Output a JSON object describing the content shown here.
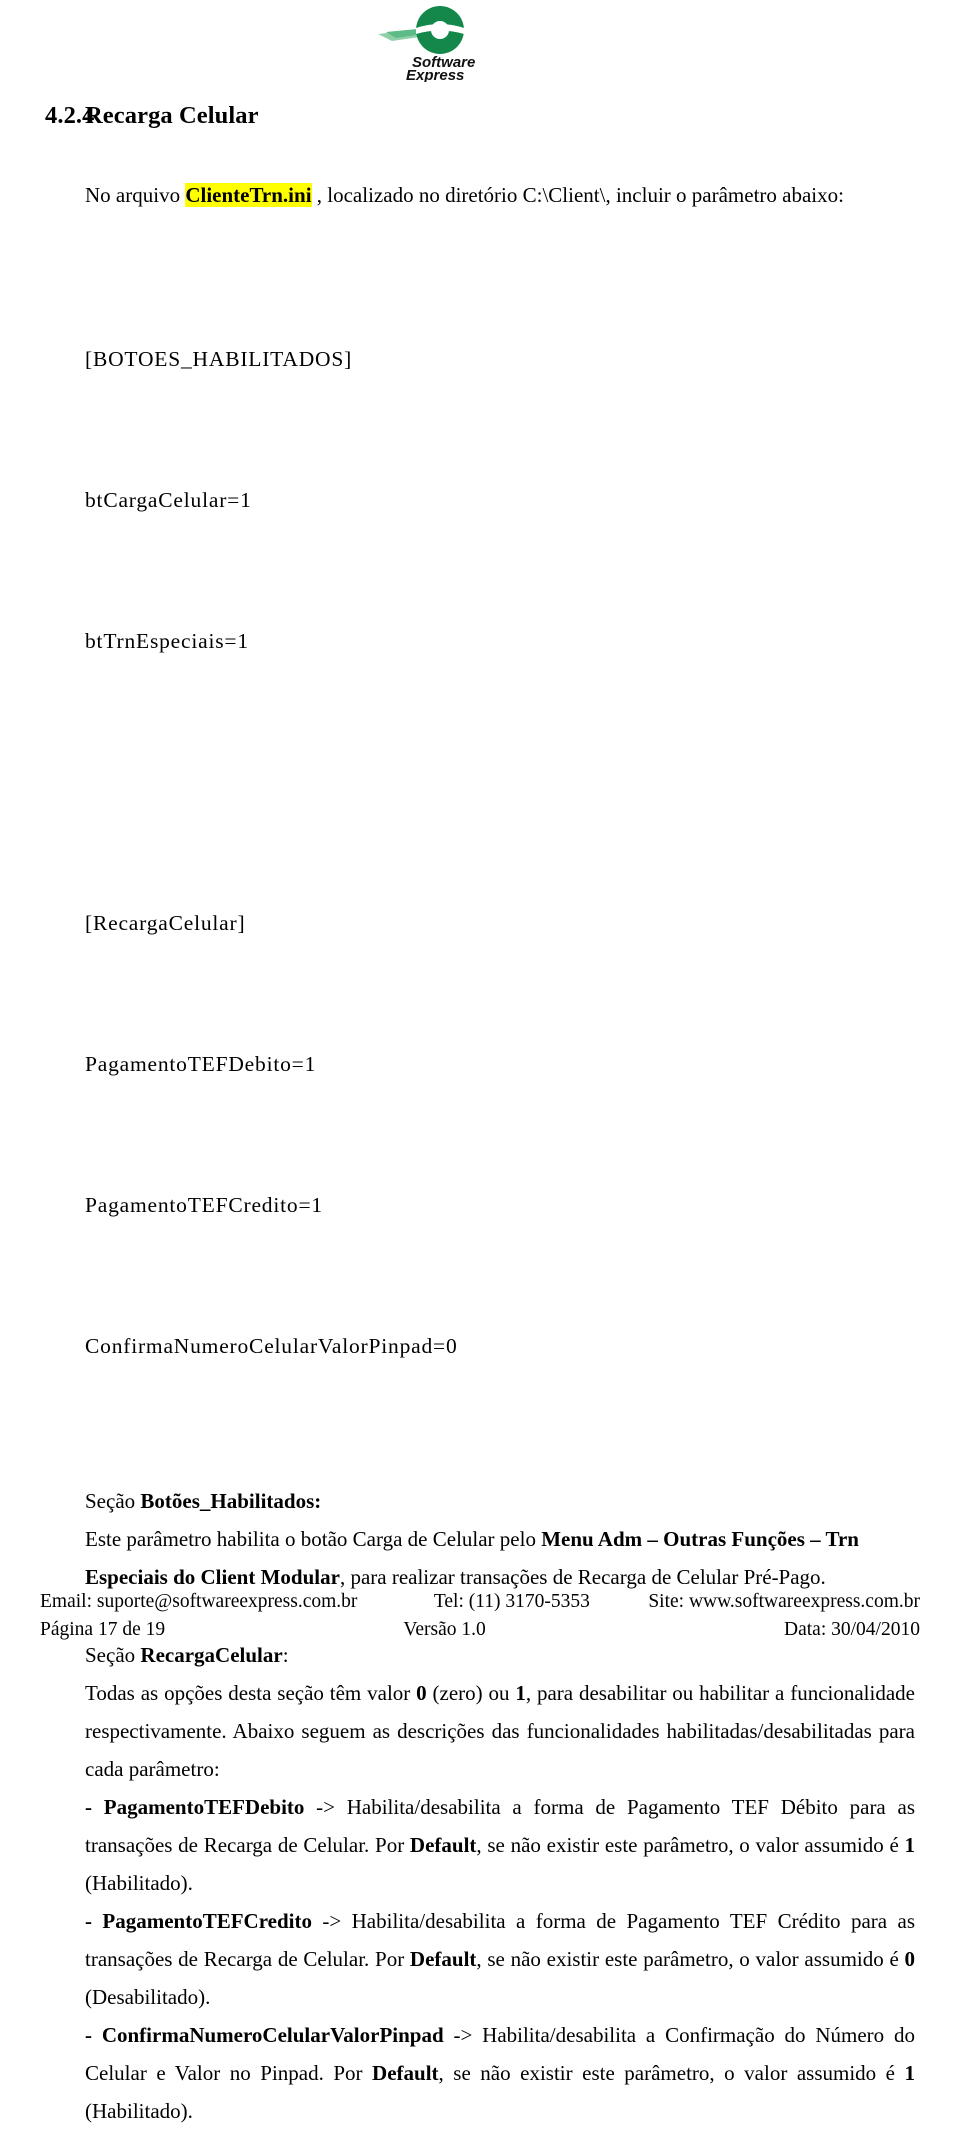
{
  "logo": {
    "name": "software-express-logo",
    "wordmark_line1": "Software",
    "wordmark_line2": "Express",
    "green": "#14884a",
    "green_light": "#7fc79b"
  },
  "heading": {
    "number": "4.2.4",
    "title": "Recarga Celular"
  },
  "intro": {
    "before": "No arquivo ",
    "highlight": "ClienteTrn.ini",
    "after": " , localizado no diretório C:\\Client\\, incluir o parâmetro abaixo:"
  },
  "ini_block": {
    "lines": [
      "[BOTOES_HABILITADOS]",
      "btCargaCelular=1",
      "btTrnEspeciais=1",
      "",
      "[RecargaCelular]",
      "PagamentoTEFDebito=1",
      "PagamentoTEFCredito=1",
      "ConfirmaNumeroCelularValorPinpad=0"
    ]
  },
  "section_botoes": {
    "label_prefix": "Seção ",
    "label_bold": "Botões_Habilitados:",
    "body_1": "Este parâmetro habilita o botão Carga de Celular pelo ",
    "body_bold_1": "Menu Adm – Outras Funções – Trn Especiais do Client Modular",
    "body_2": ", para realizar transações de Recarga de Celular Pré-Pago."
  },
  "section_recarga": {
    "label_prefix": "Seção ",
    "label_bold": "RecargaCelular",
    "label_suffix": ":",
    "intro_1": "Todas as opções desta seção têm valor ",
    "intro_b1": "0",
    "intro_2": " (zero) ou ",
    "intro_b2": "1",
    "intro_3": ", para desabilitar ou habilitar a funcionalidade respectivamente. Abaixo seguem as descrições das funcionalidades habilitadas/desabilitadas para cada parâmetro:"
  },
  "params": [
    {
      "bullet": "- ",
      "name": "PagamentoTEFDebito",
      "text_1": " -> Habilita/desabilita a forma de Pagamento TEF Débito para as transações de Recarga de Celular. Por ",
      "default_word": "Default",
      "text_2": ", se não existir este parâmetro, o valor assumido é ",
      "value": "1",
      "text_3": " (Habilitado)."
    },
    {
      "bullet": "- ",
      "name": "PagamentoTEFCredito",
      "text_1": " -> Habilita/desabilita a forma de Pagamento TEF Crédito para as transações de Recarga de Celular. Por ",
      "default_word": "Default",
      "text_2": ", se não existir este parâmetro, o valor assumido é ",
      "value": "0",
      "text_3": " (Desabilitado)."
    },
    {
      "bullet": "- ",
      "name": "ConfirmaNumeroCelularValorPinpad",
      "text_1": " -> Habilita/desabilita a Confirmação do Número do Celular e Valor no Pinpad. Por ",
      "default_word": "Default",
      "text_2": ", se não existir este parâmetro, o valor assumido é ",
      "value": "1",
      "text_3": " (Habilitado)."
    }
  ],
  "footer": {
    "email": "Email: suporte@softwareexpress.com.br",
    "tel": "Tel: (11) 3170-5353",
    "site": "Site: www.softwareexpress.com.br",
    "page": "Página 17 de 19",
    "version": "Versão 1.0",
    "date": "Data: 30/04/2010"
  }
}
